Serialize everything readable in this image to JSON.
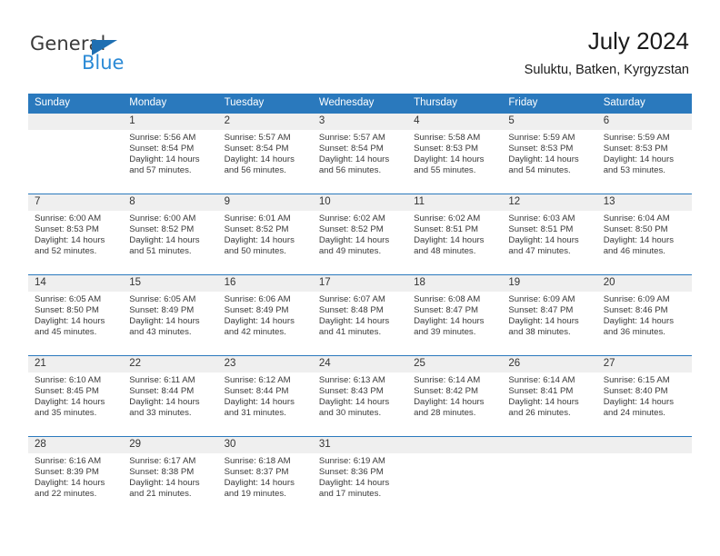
{
  "brand": {
    "word_one": "General",
    "word_two": "Blue",
    "triangle_icon": "triangle-icon",
    "color_dark": "#3a3a3a",
    "color_blue": "#2b8ad6"
  },
  "header": {
    "title": "July 2024",
    "subtitle": "Suluktu, Batken, Kyrgyzstan"
  },
  "theme": {
    "header_blue": "#2a79bd",
    "date_strip_gray": "#efefef",
    "body_white": "#ffffff",
    "text": "#3a3a3a"
  },
  "labels": {
    "sunrise": "Sunrise:",
    "sunset": "Sunset:",
    "daylight": "Daylight:"
  },
  "weekdays": [
    "Sunday",
    "Monday",
    "Tuesday",
    "Wednesday",
    "Thursday",
    "Friday",
    "Saturday"
  ],
  "weeks": [
    [
      {
        "day": "",
        "lines": []
      },
      {
        "day": "1",
        "lines": [
          "Sunrise: 5:56 AM",
          "Sunset: 8:54 PM",
          "Daylight: 14 hours",
          "and 57 minutes."
        ]
      },
      {
        "day": "2",
        "lines": [
          "Sunrise: 5:57 AM",
          "Sunset: 8:54 PM",
          "Daylight: 14 hours",
          "and 56 minutes."
        ]
      },
      {
        "day": "3",
        "lines": [
          "Sunrise: 5:57 AM",
          "Sunset: 8:54 PM",
          "Daylight: 14 hours",
          "and 56 minutes."
        ]
      },
      {
        "day": "4",
        "lines": [
          "Sunrise: 5:58 AM",
          "Sunset: 8:53 PM",
          "Daylight: 14 hours",
          "and 55 minutes."
        ]
      },
      {
        "day": "5",
        "lines": [
          "Sunrise: 5:59 AM",
          "Sunset: 8:53 PM",
          "Daylight: 14 hours",
          "and 54 minutes."
        ]
      },
      {
        "day": "6",
        "lines": [
          "Sunrise: 5:59 AM",
          "Sunset: 8:53 PM",
          "Daylight: 14 hours",
          "and 53 minutes."
        ]
      }
    ],
    [
      {
        "day": "7",
        "lines": [
          "Sunrise: 6:00 AM",
          "Sunset: 8:53 PM",
          "Daylight: 14 hours",
          "and 52 minutes."
        ]
      },
      {
        "day": "8",
        "lines": [
          "Sunrise: 6:00 AM",
          "Sunset: 8:52 PM",
          "Daylight: 14 hours",
          "and 51 minutes."
        ]
      },
      {
        "day": "9",
        "lines": [
          "Sunrise: 6:01 AM",
          "Sunset: 8:52 PM",
          "Daylight: 14 hours",
          "and 50 minutes."
        ]
      },
      {
        "day": "10",
        "lines": [
          "Sunrise: 6:02 AM",
          "Sunset: 8:52 PM",
          "Daylight: 14 hours",
          "and 49 minutes."
        ]
      },
      {
        "day": "11",
        "lines": [
          "Sunrise: 6:02 AM",
          "Sunset: 8:51 PM",
          "Daylight: 14 hours",
          "and 48 minutes."
        ]
      },
      {
        "day": "12",
        "lines": [
          "Sunrise: 6:03 AM",
          "Sunset: 8:51 PM",
          "Daylight: 14 hours",
          "and 47 minutes."
        ]
      },
      {
        "day": "13",
        "lines": [
          "Sunrise: 6:04 AM",
          "Sunset: 8:50 PM",
          "Daylight: 14 hours",
          "and 46 minutes."
        ]
      }
    ],
    [
      {
        "day": "14",
        "lines": [
          "Sunrise: 6:05 AM",
          "Sunset: 8:50 PM",
          "Daylight: 14 hours",
          "and 45 minutes."
        ]
      },
      {
        "day": "15",
        "lines": [
          "Sunrise: 6:05 AM",
          "Sunset: 8:49 PM",
          "Daylight: 14 hours",
          "and 43 minutes."
        ]
      },
      {
        "day": "16",
        "lines": [
          "Sunrise: 6:06 AM",
          "Sunset: 8:49 PM",
          "Daylight: 14 hours",
          "and 42 minutes."
        ]
      },
      {
        "day": "17",
        "lines": [
          "Sunrise: 6:07 AM",
          "Sunset: 8:48 PM",
          "Daylight: 14 hours",
          "and 41 minutes."
        ]
      },
      {
        "day": "18",
        "lines": [
          "Sunrise: 6:08 AM",
          "Sunset: 8:47 PM",
          "Daylight: 14 hours",
          "and 39 minutes."
        ]
      },
      {
        "day": "19",
        "lines": [
          "Sunrise: 6:09 AM",
          "Sunset: 8:47 PM",
          "Daylight: 14 hours",
          "and 38 minutes."
        ]
      },
      {
        "day": "20",
        "lines": [
          "Sunrise: 6:09 AM",
          "Sunset: 8:46 PM",
          "Daylight: 14 hours",
          "and 36 minutes."
        ]
      }
    ],
    [
      {
        "day": "21",
        "lines": [
          "Sunrise: 6:10 AM",
          "Sunset: 8:45 PM",
          "Daylight: 14 hours",
          "and 35 minutes."
        ]
      },
      {
        "day": "22",
        "lines": [
          "Sunrise: 6:11 AM",
          "Sunset: 8:44 PM",
          "Daylight: 14 hours",
          "and 33 minutes."
        ]
      },
      {
        "day": "23",
        "lines": [
          "Sunrise: 6:12 AM",
          "Sunset: 8:44 PM",
          "Daylight: 14 hours",
          "and 31 minutes."
        ]
      },
      {
        "day": "24",
        "lines": [
          "Sunrise: 6:13 AM",
          "Sunset: 8:43 PM",
          "Daylight: 14 hours",
          "and 30 minutes."
        ]
      },
      {
        "day": "25",
        "lines": [
          "Sunrise: 6:14 AM",
          "Sunset: 8:42 PM",
          "Daylight: 14 hours",
          "and 28 minutes."
        ]
      },
      {
        "day": "26",
        "lines": [
          "Sunrise: 6:14 AM",
          "Sunset: 8:41 PM",
          "Daylight: 14 hours",
          "and 26 minutes."
        ]
      },
      {
        "day": "27",
        "lines": [
          "Sunrise: 6:15 AM",
          "Sunset: 8:40 PM",
          "Daylight: 14 hours",
          "and 24 minutes."
        ]
      }
    ],
    [
      {
        "day": "28",
        "lines": [
          "Sunrise: 6:16 AM",
          "Sunset: 8:39 PM",
          "Daylight: 14 hours",
          "and 22 minutes."
        ]
      },
      {
        "day": "29",
        "lines": [
          "Sunrise: 6:17 AM",
          "Sunset: 8:38 PM",
          "Daylight: 14 hours",
          "and 21 minutes."
        ]
      },
      {
        "day": "30",
        "lines": [
          "Sunrise: 6:18 AM",
          "Sunset: 8:37 PM",
          "Daylight: 14 hours",
          "and 19 minutes."
        ]
      },
      {
        "day": "31",
        "lines": [
          "Sunrise: 6:19 AM",
          "Sunset: 8:36 PM",
          "Daylight: 14 hours",
          "and 17 minutes."
        ]
      },
      {
        "day": "",
        "lines": []
      },
      {
        "day": "",
        "lines": []
      },
      {
        "day": "",
        "lines": []
      }
    ]
  ]
}
